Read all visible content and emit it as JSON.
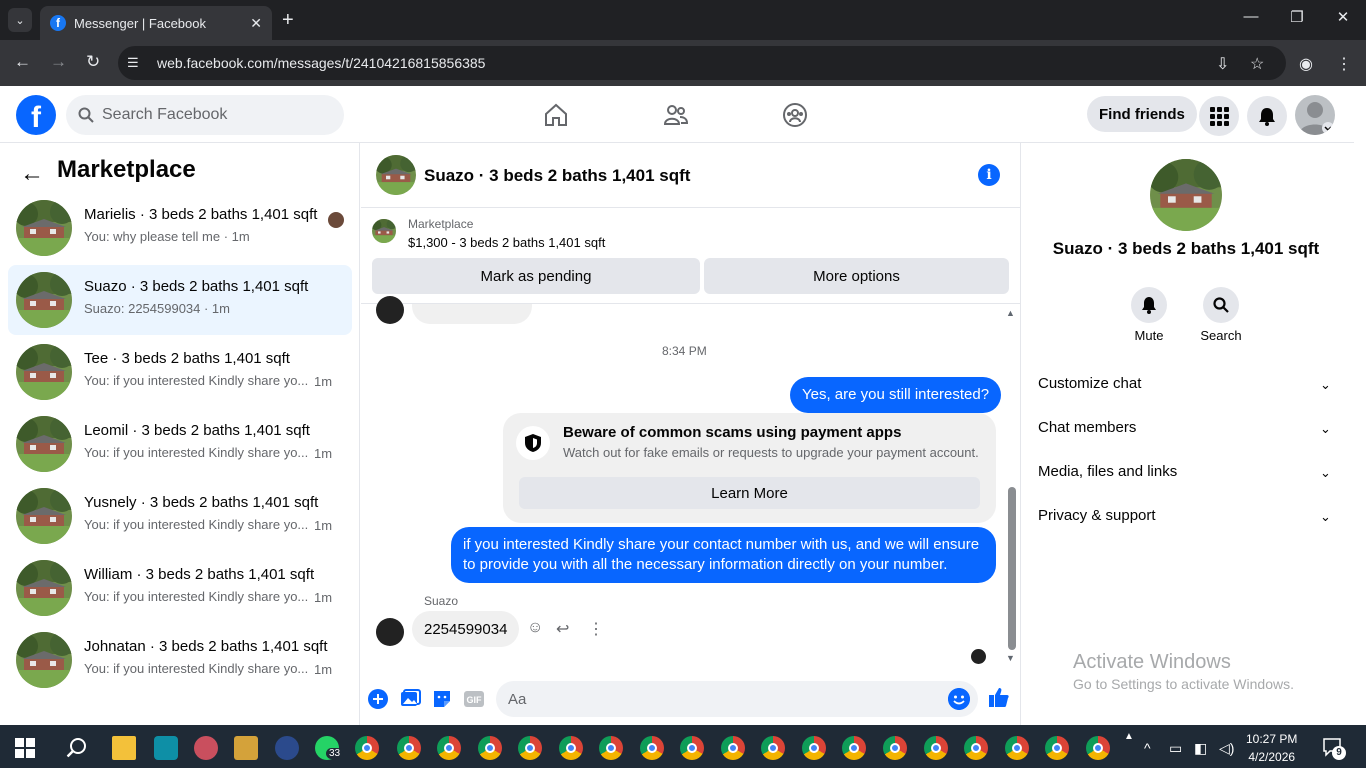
{
  "browser": {
    "tab_title": "Messenger | Facebook",
    "url": "web.facebook.com/messages/t/24104216815856385"
  },
  "header": {
    "search_placeholder": "Search Facebook",
    "find_friends": "Find friends"
  },
  "left": {
    "title": "Marketplace",
    "conversations": [
      {
        "name": "Marielis · 3 beds 2 baths 1,401 sqft",
        "preview": "You: why please tell me · 1m",
        "time": "",
        "active": false
      },
      {
        "name": "Suazo · 3 beds 2 baths 1,401 sqft",
        "preview": "Suazo: 2254599034 · 1m",
        "time": "",
        "active": true
      },
      {
        "name": "Tee · 3 beds 2 baths 1,401 sqft",
        "preview": "You: if you interested Kindly share yo...",
        "time": "1m",
        "active": false
      },
      {
        "name": "Leomil · 3 beds 2 baths 1,401 sqft",
        "preview": "You: if you interested Kindly share yo...",
        "time": "1m",
        "active": false
      },
      {
        "name": "Yusnely · 3 beds 2 baths 1,401 sqft",
        "preview": "You: if you interested Kindly share yo...",
        "time": "1m",
        "active": false
      },
      {
        "name": "William · 3 beds 2 baths 1,401 sqft",
        "preview": "You: if you interested Kindly share yo...",
        "time": "1m",
        "active": false
      },
      {
        "name": "Johnatan · 3 beds 2 baths 1,401 sqft",
        "preview": "You: if you interested Kindly share yo...",
        "time": "1m",
        "active": false
      }
    ]
  },
  "chat": {
    "title": "Suazo · 3 beds 2 baths 1,401 sqft",
    "marketplace_label": "Marketplace",
    "listing": "$1,300 - 3 beds 2 baths 1,401 sqft",
    "mark_pending": "Mark as pending",
    "more_options": "More options",
    "timestamp": "8:34 PM",
    "msg_out_1": "Yes, are you still interested?",
    "scam_title": "Beware of common scams using payment apps",
    "scam_sub": "Watch out for fake emails or requests to upgrade your payment account.",
    "learn_more": "Learn More",
    "msg_out_2_line1": "if you interested Kindly share your contact number with us, and we will ensure",
    "msg_out_2_line2": "to provide you with all the necessary information directly on your number.",
    "sender": "Suazo",
    "msg_in": "2254599034",
    "composer_placeholder": "Aa"
  },
  "right": {
    "title": "Suazo · 3 beds 2 baths 1,401 sqft",
    "mute": "Mute",
    "search": "Search",
    "rows": [
      "Customize chat",
      "Chat members",
      "Media, files and links",
      "Privacy & support"
    ]
  },
  "watermark": {
    "line1": "Activate Windows",
    "line2": "Go to Settings to activate Windows."
  },
  "taskbar": {
    "time": "10:27 PM",
    "date": "4/2/2026",
    "whatsapp_badge": "33",
    "notif_count": "9"
  }
}
